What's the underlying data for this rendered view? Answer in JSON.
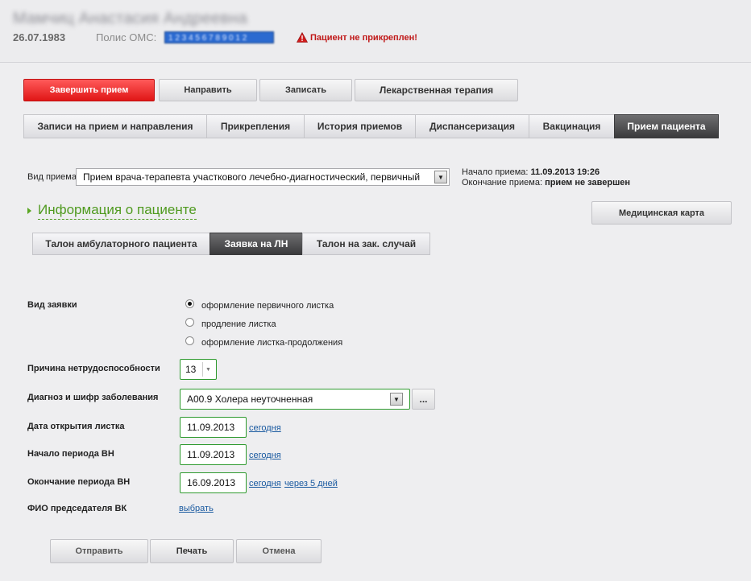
{
  "header": {
    "patient_name": "Мамчиц Анастасия Андреевна",
    "birth_date": "26.07.1983",
    "oms_label": "Полис ОМС:",
    "oms_value": "1 2 3 4 5 6 7 8 9 0 1 2",
    "warning": "Пациент не прикреплен!"
  },
  "actions": {
    "finish": "Завершить прием",
    "refer": "Направить",
    "record": "Записать",
    "drug_therapy": "Лекарственная терапия"
  },
  "main_tabs": [
    "Записи на прием и направления",
    "Прикрепления",
    "История приемов",
    "Диспансеризация",
    "Вакцинация",
    "Прием пациента"
  ],
  "visit": {
    "type_label": "Вид приема",
    "type_value": "Прием врача-терапевта участкового лечебно-диагностический, первичный",
    "start_label": "Начало приема:",
    "start_value": "11.09.2013 19:26",
    "end_label": "Окончание приема:",
    "end_value": "прием не завершен",
    "med_card": "Медицинская карта"
  },
  "sub_tabs": [
    "Талон амбулаторного пациента",
    "Заявка на ЛН",
    "Талон на зак. случай"
  ],
  "section_title": "Информация о пациенте",
  "form": {
    "request_type_label": "Вид заявки",
    "options": [
      "оформление первичного листка",
      "продление листка",
      "оформление листка-продолжения"
    ],
    "cause_label": "Причина нетрудоспособности",
    "cause_value": "13",
    "diagnosis_label": "Диагноз и шифр заболевания",
    "diagnosis_value": "A00.9 Холера неуточненная",
    "more_btn": "...",
    "open_date_label": "Дата открытия листка",
    "open_date_value": "11.09.2013",
    "period_start_label": "Начало периода ВН",
    "period_start_value": "11.09.2013",
    "period_end_label": "Окончание периода ВН",
    "period_end_value": "16.09.2013",
    "today_link": "сегодня",
    "in5days_link": "через 5 дней",
    "chairman_label": "ФИО председателя ВК",
    "choose_link": "выбрать"
  },
  "footer": {
    "send": "Отправить",
    "print": "Печать",
    "cancel": "Отмена"
  },
  "colors": {
    "accent_red": "#e01616",
    "active_tab": "#3a3a3c",
    "section_green": "#4f9a1f",
    "field_border_green": "#2e9a2e",
    "link_blue": "#1a5aa0"
  },
  "icons": {
    "warning": "warning-triangle-icon",
    "dropdown": "chevron-down-icon",
    "section": "triangle-right-icon"
  }
}
